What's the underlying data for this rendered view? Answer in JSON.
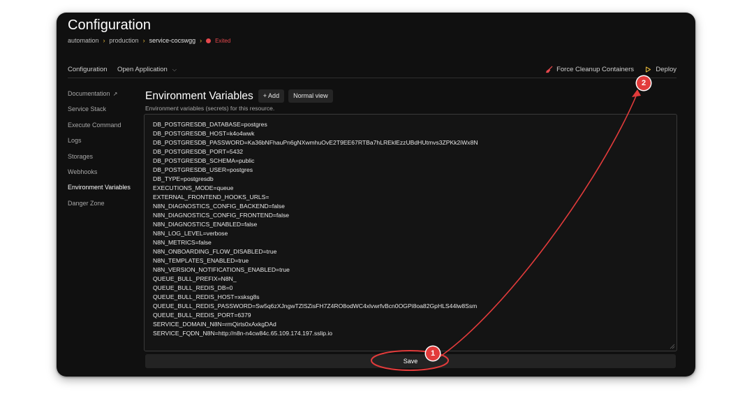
{
  "header": {
    "title": "Configuration",
    "breadcrumb": [
      "automation",
      "production",
      "service-cocswgg"
    ],
    "status": "Exited"
  },
  "topnav": {
    "configuration": "Configuration",
    "open_application": "Open Application",
    "force_cleanup": "Force Cleanup Containers",
    "deploy": "Deploy"
  },
  "sidebar": {
    "items": [
      {
        "label": "Documentation",
        "active": false
      },
      {
        "label": "Service Stack",
        "active": false
      },
      {
        "label": "Execute Command",
        "active": false
      },
      {
        "label": "Logs",
        "active": false
      },
      {
        "label": "Storages",
        "active": false
      },
      {
        "label": "Webhooks",
        "active": false
      },
      {
        "label": "Environment Variables",
        "active": true
      },
      {
        "label": "Danger Zone",
        "active": false
      }
    ]
  },
  "main": {
    "title": "Environment Variables",
    "add_button": "+ Add",
    "normal_view_button": "Normal view",
    "subtitle": "Environment variables (secrets) for this resource.",
    "env_lines": [
      "DB_POSTGRESDB_DATABASE=postgres",
      "DB_POSTGRESDB_HOST=k4o4wwk",
      "DB_POSTGRESDB_PASSWORD=Ka36bNFhauPn6gNXwmhuOvE2T9EE67RTBa7hLREklEzzUBdHUtmvs3ZPKk2iWx8N",
      "DB_POSTGRESDB_PORT=5432",
      "DB_POSTGRESDB_SCHEMA=public",
      "DB_POSTGRESDB_USER=postgres",
      "DB_TYPE=postgresdb",
      "EXECUTIONS_MODE=queue",
      "EXTERNAL_FRONTEND_HOOKS_URLS=",
      "N8N_DIAGNOSTICS_CONFIG_BACKEND=false",
      "N8N_DIAGNOSTICS_CONFIG_FRONTEND=false",
      "N8N_DIAGNOSTICS_ENABLED=false",
      "N8N_LOG_LEVEL=verbose",
      "N8N_METRICS=false",
      "N8N_ONBOARDING_FLOW_DISABLED=true",
      "N8N_TEMPLATES_ENABLED=true",
      "N8N_VERSION_NOTIFICATIONS_ENABLED=true",
      "QUEUE_BULL_PREFIX=N8N_",
      "QUEUE_BULL_REDIS_DB=0",
      "QUEUE_BULL_REDIS_HOST=xsksg8s",
      "QUEUE_BULL_REDIS_PASSWORD=Sw5q6zXJngwTZlSZisFH7Z4RO8odWC4xlvwrfvBcn0OGPi8oa82GpHLS44lw8Ssm",
      "QUEUE_BULL_REDIS_PORT=6379",
      "SERVICE_DOMAIN_N8N=rmQirts0xAxkgDAd",
      "SERVICE_FQDN_N8N=http://n8n-n4cw84c.65.109.174.197.sslip.io"
    ],
    "save_button": "Save"
  },
  "annotations": {
    "step1": "1",
    "step2": "2",
    "color": "#e23b3b"
  }
}
